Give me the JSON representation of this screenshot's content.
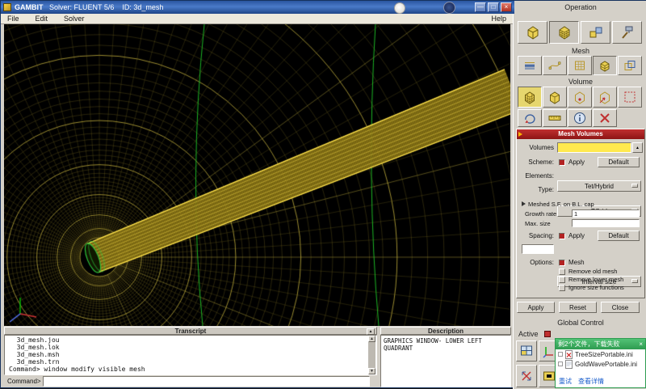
{
  "window": {
    "app": "GAMBIT",
    "title": "   Solver: FLUENT 5/6    ID: 3d_mesh"
  },
  "menu": {
    "items": [
      "File",
      "Edit",
      "Solver"
    ],
    "help": "Help"
  },
  "icons": {
    "minimize": "—",
    "maximize": "□",
    "close": "×",
    "pick": "▲",
    "up": "▲",
    "down": "▼",
    "popup_close": "×",
    "expand": "▲"
  },
  "panel": {
    "operation_label": "Operation",
    "mesh_label": "Mesh",
    "volume_label": "Volume",
    "global_control_label": "Global Control",
    "active_label": "Active",
    "form": {
      "title": "Mesh Volumes",
      "volumes_label": "Volumes",
      "volumes_value": "",
      "scheme_label": "Scheme:",
      "apply_label": "Apply",
      "default_label": "Default",
      "elements_label": "Elements:",
      "elements_value": "Tet/Hybrid",
      "type_label": "Type:",
      "type_value": "TGrid",
      "blcap_label": "Meshed S.F. on B.L. cap",
      "growth_label": "Growth rate",
      "growth_value": "1",
      "maxsize_label": "Max. size",
      "maxsize_value": "",
      "spacing_label": "Spacing:",
      "spacing_value": "",
      "interval_label": "Interval size",
      "options_label": "Options:",
      "opt_mesh": "Mesh",
      "opt_remove_old": "Remove old mesh",
      "opt_remove_lower": "Remove lower mesh",
      "opt_ignore": "Ignore size functions",
      "apply_button": "Apply",
      "reset_button": "Reset",
      "close_button": "Close"
    }
  },
  "transcript": {
    "title": "Transcript",
    "lines": [
      "  3d_mesh.jou",
      "  3d_mesh.lok",
      "  3d_mesh.msh",
      "  3d_mesh.trn",
      "Command> window modify visible mesh"
    ],
    "command_label": "Command>",
    "command_value": ""
  },
  "description": {
    "title": "Description",
    "text": "GRAPHICS WINDOW- LOWER LEFT QUADRANT"
  },
  "popup": {
    "title": "剩2个文件，下载失败",
    "files": [
      "TreeSizePortable.ini",
      "GoldWavePortable.ini"
    ],
    "links": [
      "重试",
      "查看详情"
    ]
  }
}
